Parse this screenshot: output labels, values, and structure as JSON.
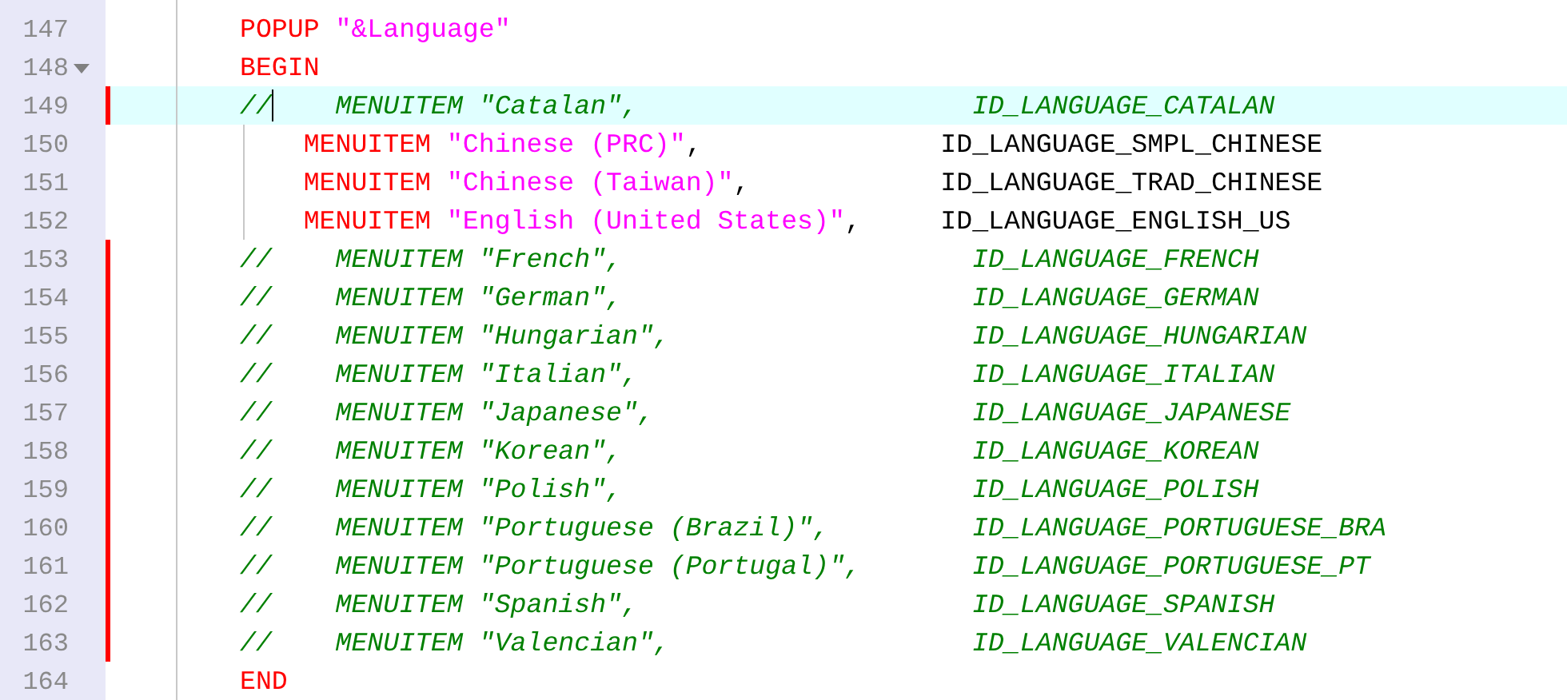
{
  "editor": {
    "lines": [
      {
        "number": "147",
        "changed": false,
        "current": false,
        "foldable": false,
        "indent_guide": false,
        "caret": false,
        "segments": [
          {
            "kind": "keyword",
            "text": "POPUP"
          },
          {
            "kind": "string",
            "text": " \"&Language\""
          }
        ]
      },
      {
        "number": "148",
        "changed": false,
        "current": false,
        "foldable": true,
        "indent_guide": false,
        "caret": false,
        "segments": [
          {
            "kind": "keyword",
            "text": "BEGIN"
          }
        ]
      },
      {
        "number": "149",
        "changed": true,
        "current": true,
        "foldable": false,
        "indent_guide": false,
        "caret": true,
        "segments": [
          {
            "kind": "comment",
            "text": "//    MENUITEM \"Catalan\",                     ID_LANGUAGE_CATALAN"
          }
        ]
      },
      {
        "number": "150",
        "changed": false,
        "current": false,
        "foldable": false,
        "indent_guide": true,
        "caret": false,
        "segments": [
          {
            "kind": "keyword",
            "text": "    MENUITEM"
          },
          {
            "kind": "string",
            "text": " \"Chinese (PRC)\""
          },
          {
            "kind": "plain",
            "text": ",               ID_LANGUAGE_SMPL_CHINESE"
          }
        ]
      },
      {
        "number": "151",
        "changed": false,
        "current": false,
        "foldable": false,
        "indent_guide": true,
        "caret": false,
        "segments": [
          {
            "kind": "keyword",
            "text": "    MENUITEM"
          },
          {
            "kind": "string",
            "text": " \"Chinese (Taiwan)\""
          },
          {
            "kind": "plain",
            "text": ",            ID_LANGUAGE_TRAD_CHINESE"
          }
        ]
      },
      {
        "number": "152",
        "changed": false,
        "current": false,
        "foldable": false,
        "indent_guide": true,
        "caret": false,
        "segments": [
          {
            "kind": "keyword",
            "text": "    MENUITEM"
          },
          {
            "kind": "string",
            "text": " \"English (United States)\""
          },
          {
            "kind": "plain",
            "text": ",     ID_LANGUAGE_ENGLISH_US"
          }
        ]
      },
      {
        "number": "153",
        "changed": true,
        "current": false,
        "foldable": false,
        "indent_guide": false,
        "caret": false,
        "segments": [
          {
            "kind": "comment",
            "text": "//    MENUITEM \"French\",                      ID_LANGUAGE_FRENCH"
          }
        ]
      },
      {
        "number": "154",
        "changed": true,
        "current": false,
        "foldable": false,
        "indent_guide": false,
        "caret": false,
        "segments": [
          {
            "kind": "comment",
            "text": "//    MENUITEM \"German\",                      ID_LANGUAGE_GERMAN"
          }
        ]
      },
      {
        "number": "155",
        "changed": true,
        "current": false,
        "foldable": false,
        "indent_guide": false,
        "caret": false,
        "segments": [
          {
            "kind": "comment",
            "text": "//    MENUITEM \"Hungarian\",                   ID_LANGUAGE_HUNGARIAN"
          }
        ]
      },
      {
        "number": "156",
        "changed": true,
        "current": false,
        "foldable": false,
        "indent_guide": false,
        "caret": false,
        "segments": [
          {
            "kind": "comment",
            "text": "//    MENUITEM \"Italian\",                     ID_LANGUAGE_ITALIAN"
          }
        ]
      },
      {
        "number": "157",
        "changed": true,
        "current": false,
        "foldable": false,
        "indent_guide": false,
        "caret": false,
        "segments": [
          {
            "kind": "comment",
            "text": "//    MENUITEM \"Japanese\",                    ID_LANGUAGE_JAPANESE"
          }
        ]
      },
      {
        "number": "158",
        "changed": true,
        "current": false,
        "foldable": false,
        "indent_guide": false,
        "caret": false,
        "segments": [
          {
            "kind": "comment",
            "text": "//    MENUITEM \"Korean\",                      ID_LANGUAGE_KOREAN"
          }
        ]
      },
      {
        "number": "159",
        "changed": true,
        "current": false,
        "foldable": false,
        "indent_guide": false,
        "caret": false,
        "segments": [
          {
            "kind": "comment",
            "text": "//    MENUITEM \"Polish\",                      ID_LANGUAGE_POLISH"
          }
        ]
      },
      {
        "number": "160",
        "changed": true,
        "current": false,
        "foldable": false,
        "indent_guide": false,
        "caret": false,
        "segments": [
          {
            "kind": "comment",
            "text": "//    MENUITEM \"Portuguese (Brazil)\",         ID_LANGUAGE_PORTUGUESE_BRA"
          }
        ]
      },
      {
        "number": "161",
        "changed": true,
        "current": false,
        "foldable": false,
        "indent_guide": false,
        "caret": false,
        "segments": [
          {
            "kind": "comment",
            "text": "//    MENUITEM \"Portuguese (Portugal)\",       ID_LANGUAGE_PORTUGUESE_PT"
          }
        ]
      },
      {
        "number": "162",
        "changed": true,
        "current": false,
        "foldable": false,
        "indent_guide": false,
        "caret": false,
        "segments": [
          {
            "kind": "comment",
            "text": "//    MENUITEM \"Spanish\",                     ID_LANGUAGE_SPANISH"
          }
        ]
      },
      {
        "number": "163",
        "changed": true,
        "current": false,
        "foldable": false,
        "indent_guide": false,
        "caret": false,
        "segments": [
          {
            "kind": "comment",
            "text": "//    MENUITEM \"Valencian\",                   ID_LANGUAGE_VALENCIAN"
          }
        ]
      },
      {
        "number": "164",
        "changed": false,
        "current": false,
        "foldable": false,
        "indent_guide": false,
        "caret": false,
        "segments": [
          {
            "kind": "keyword",
            "text": "END"
          }
        ]
      }
    ]
  }
}
